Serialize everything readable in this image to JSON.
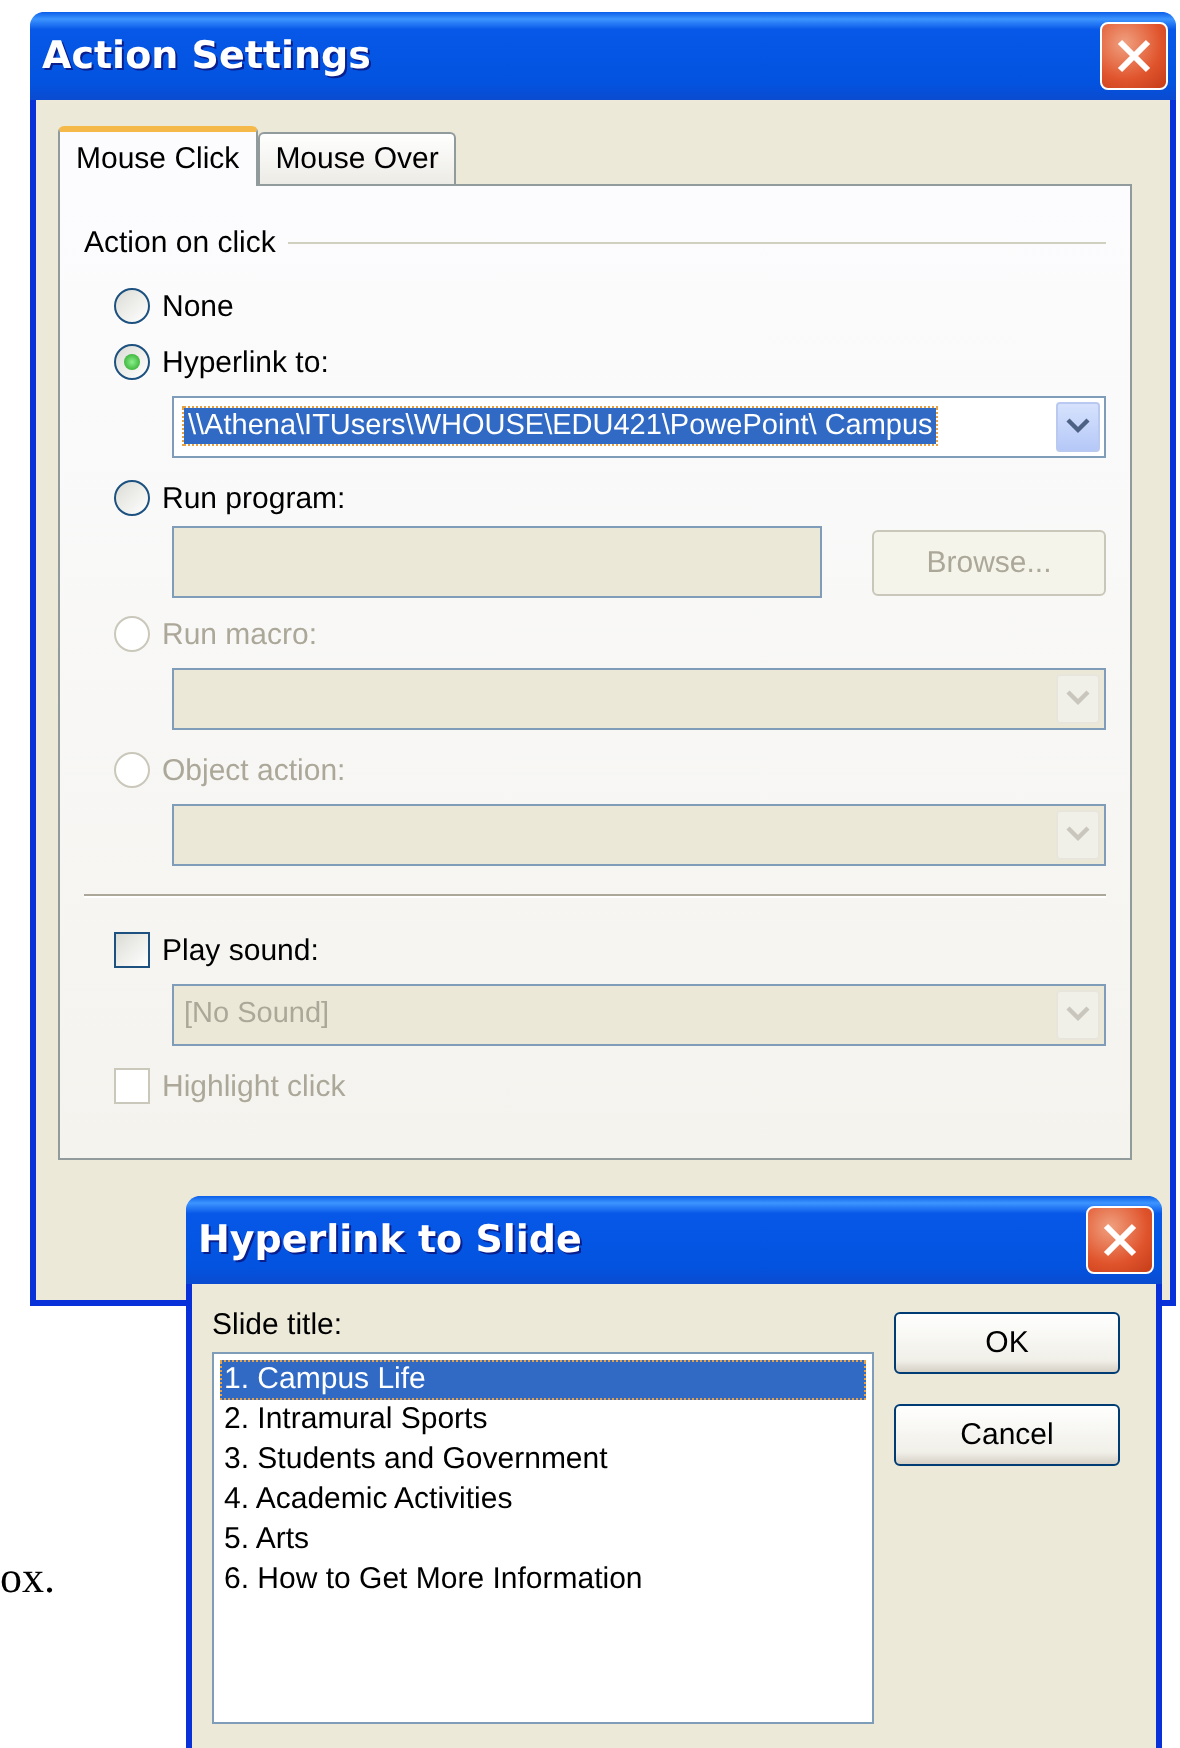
{
  "document_text": "ox.",
  "action_settings": {
    "title": "Action Settings",
    "tabs": [
      {
        "label": "Mouse Click",
        "selected": true
      },
      {
        "label": "Mouse Over",
        "selected": false
      }
    ],
    "group_label": "Action on click",
    "options": [
      {
        "kind": "radio",
        "label": "None",
        "selected": false,
        "disabled": false
      },
      {
        "kind": "radio",
        "label": "Hyperlink to:",
        "selected": true,
        "disabled": false,
        "field": {
          "kind": "combo",
          "value": "\\\\Athena\\ITUsers\\WHOUSE\\EDU421\\PowePoint\\ Campus",
          "disabled": false,
          "text_selected": true
        }
      },
      {
        "kind": "radio",
        "label": "Run program:",
        "selected": false,
        "disabled": false,
        "field": {
          "kind": "text",
          "disabled": true
        },
        "button": {
          "label": "Browse...",
          "disabled": true
        }
      },
      {
        "kind": "radio",
        "label": "Run macro:",
        "selected": false,
        "disabled": true,
        "field": {
          "kind": "combo",
          "disabled": true
        }
      },
      {
        "kind": "radio",
        "label": "Object action:",
        "selected": false,
        "disabled": true,
        "field": {
          "kind": "combo",
          "disabled": true
        }
      }
    ],
    "sound": {
      "label": "Play sound:",
      "checked": false,
      "disabled": false,
      "field": {
        "kind": "combo",
        "value": "[No Sound]",
        "disabled": true
      }
    },
    "highlight": {
      "label": "Highlight click",
      "checked": false,
      "disabled": true
    }
  },
  "hyperlink_dialog": {
    "title": "Hyperlink to Slide",
    "list_label": "Slide title:",
    "slides": [
      {
        "label": "1. Campus Life",
        "selected": true
      },
      {
        "label": "2. Intramural Sports",
        "selected": false
      },
      {
        "label": "3. Students and Government",
        "selected": false
      },
      {
        "label": "4. Academic Activities",
        "selected": false
      },
      {
        "label": "5. Arts",
        "selected": false
      },
      {
        "label": "6. How to Get More Information",
        "selected": false
      }
    ],
    "buttons": [
      {
        "label": "OK"
      },
      {
        "label": "Cancel"
      }
    ]
  }
}
